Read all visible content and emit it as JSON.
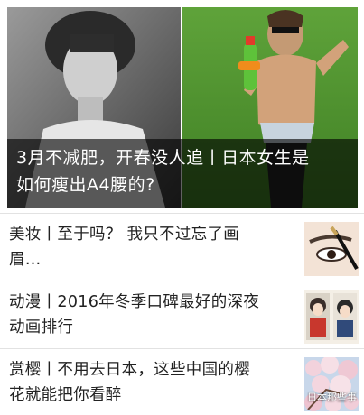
{
  "hero": {
    "title": "3月不减肥，开春没人追丨日本女生是如何瘦出A4腰的?",
    "title_line1": "3月不减肥，开春没人追丨日本女生是",
    "title_line2": "如何瘦出A4腰的?"
  },
  "articles": [
    {
      "line1": "美妆丨至于吗？ 我只不过忘了画",
      "line2": "眉…",
      "thumb_icon": "makeup-eyebrow-photo"
    },
    {
      "line1": "动漫丨2016年冬季口碑最好的深夜",
      "line2": "动画排行",
      "thumb_icon": "anime-poster-photo"
    },
    {
      "line1": "赏樱丨不用去日本，这些中国的樱",
      "line2": "花就能把你看醉",
      "thumb_icon": "cherry-blossom-photo"
    }
  ],
  "watermark": {
    "label": "日本那些事",
    "icon": "wechat-icon"
  },
  "colors": {
    "caption_bg": "#000000",
    "text_primary": "#222222",
    "divider": "#e2e2e2"
  }
}
